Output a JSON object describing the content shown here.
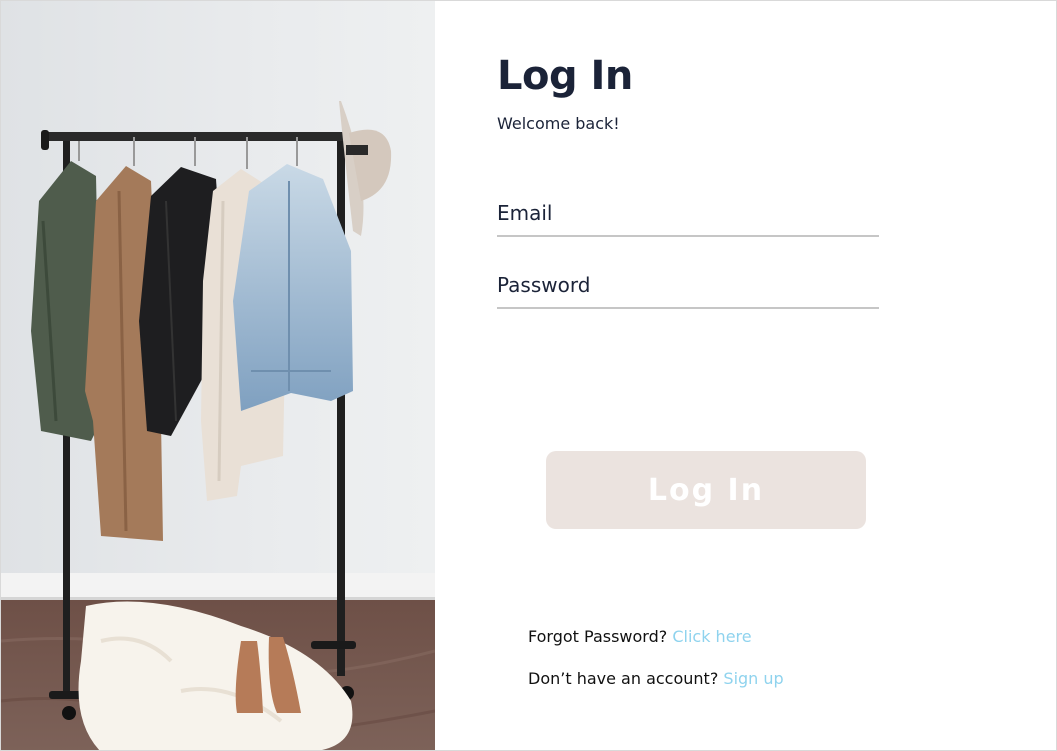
{
  "form": {
    "title": "Log In",
    "subtitle": "Welcome back!",
    "email_placeholder": "Email",
    "password_placeholder": "Password",
    "submit_label": "Log In",
    "forgot_text": "Forgot Password?",
    "forgot_link": "Click here",
    "signup_text": "Don’t have an account?",
    "signup_link": "Sign up"
  },
  "colors": {
    "heading": "#1b2338",
    "button_bg": "#ebe3df",
    "button_text": "#ffffff",
    "link": "#8fd3ee",
    "underline": "#c6c6c6"
  }
}
